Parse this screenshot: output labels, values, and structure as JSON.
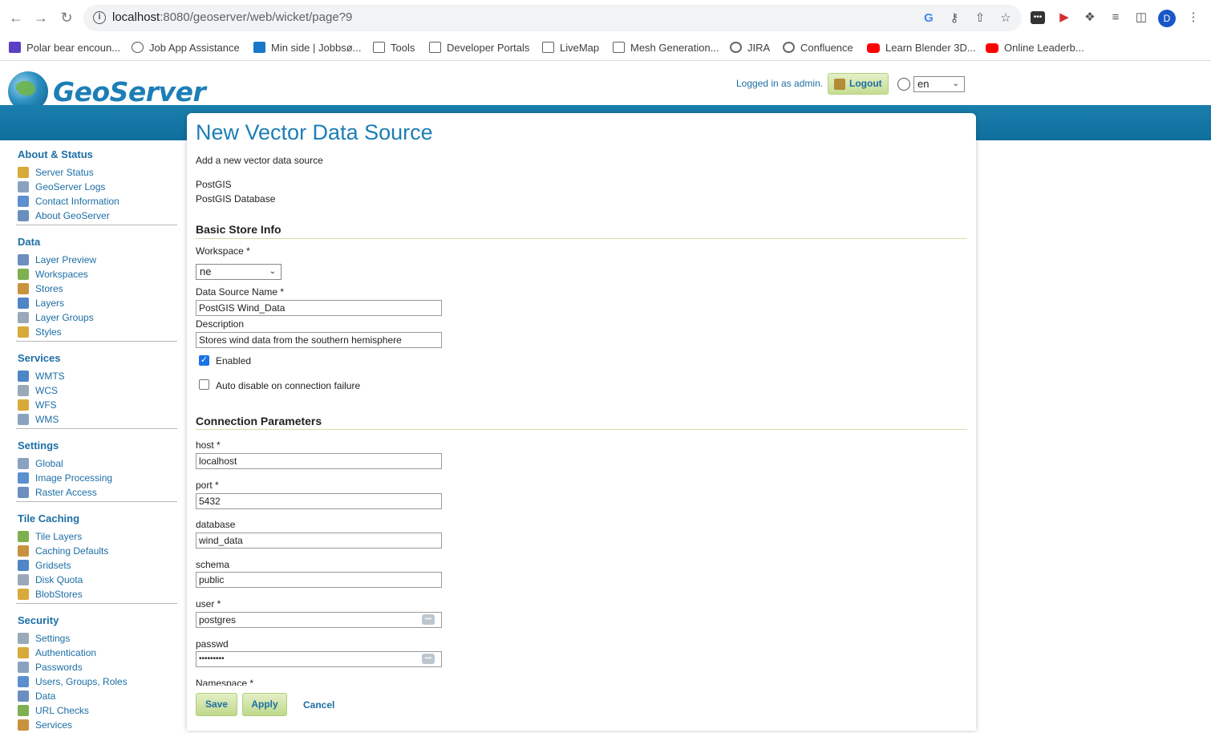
{
  "browser": {
    "url_host": "localhost",
    "url_rest": ":8080/geoserver/web/wicket/page?9",
    "profile_initial": "D",
    "bookmarks": [
      {
        "label": "Polar bear encoun...",
        "icon": "purple"
      },
      {
        "label": "Job App Assistance",
        "icon": "green"
      },
      {
        "label": "Min side | Jobbsø...",
        "icon": "blue"
      },
      {
        "label": "Tools",
        "icon": "folder"
      },
      {
        "label": "Developer Portals",
        "icon": "folder"
      },
      {
        "label": "LiveMap",
        "icon": "folder"
      },
      {
        "label": "Mesh Generation...",
        "icon": "folder"
      },
      {
        "label": "JIRA",
        "icon": "ring"
      },
      {
        "label": "Confluence",
        "icon": "ring"
      },
      {
        "label": "Learn Blender 3D...",
        "icon": "yt"
      },
      {
        "label": "Online Leaderb...",
        "icon": "yt"
      }
    ],
    "more": "»"
  },
  "header": {
    "logo_text": "GeoServer",
    "logged_in": "Logged in as admin.",
    "logout": "Logout",
    "language": "en"
  },
  "sidebar": {
    "sections": [
      {
        "title": "About & Status",
        "items": [
          "Server Status",
          "GeoServer Logs",
          "Contact Information",
          "About GeoServer"
        ]
      },
      {
        "title": "Data",
        "items": [
          "Layer Preview",
          "Workspaces",
          "Stores",
          "Layers",
          "Layer Groups",
          "Styles"
        ]
      },
      {
        "title": "Services",
        "items": [
          "WMTS",
          "WCS",
          "WFS",
          "WMS"
        ]
      },
      {
        "title": "Settings",
        "items": [
          "Global",
          "Image Processing",
          "Raster Access"
        ]
      },
      {
        "title": "Tile Caching",
        "items": [
          "Tile Layers",
          "Caching Defaults",
          "Gridsets",
          "Disk Quota",
          "BlobStores"
        ]
      },
      {
        "title": "Security",
        "items": [
          "Settings",
          "Authentication",
          "Passwords",
          "Users, Groups, Roles",
          "Data",
          "URL Checks",
          "Services"
        ]
      }
    ]
  },
  "main": {
    "title": "New Vector Data Source",
    "subtitle": "Add a new vector data source",
    "store_type": "PostGIS",
    "store_desc": "PostGIS Database",
    "basic_heading": "Basic Store Info",
    "workspace_label": "Workspace *",
    "workspace_value": "ne",
    "name_label": "Data Source Name *",
    "name_value": "PostGIS Wind_Data",
    "description_label": "Description",
    "description_value": "Stores wind data from the southern hemisphere",
    "enabled_label": "Enabled",
    "enabled_checked": true,
    "auto_disable_label": "Auto disable on connection failure",
    "auto_disable_checked": false,
    "conn_heading": "Connection Parameters",
    "host_label": "host *",
    "host_value": "localhost",
    "port_label": "port *",
    "port_value": "5432",
    "database_label": "database",
    "database_value": "wind_data",
    "schema_label": "schema",
    "schema_value": "public",
    "user_label": "user *",
    "user_value": "postgres",
    "passwd_label": "passwd",
    "passwd_value": "•••••••••",
    "namespace_label": "Namespace *",
    "save": "Save",
    "apply": "Apply",
    "cancel": "Cancel"
  },
  "colors": {
    "link": "#1c6ea4",
    "band": "#1278a8",
    "button_green": "#c6dd92"
  }
}
